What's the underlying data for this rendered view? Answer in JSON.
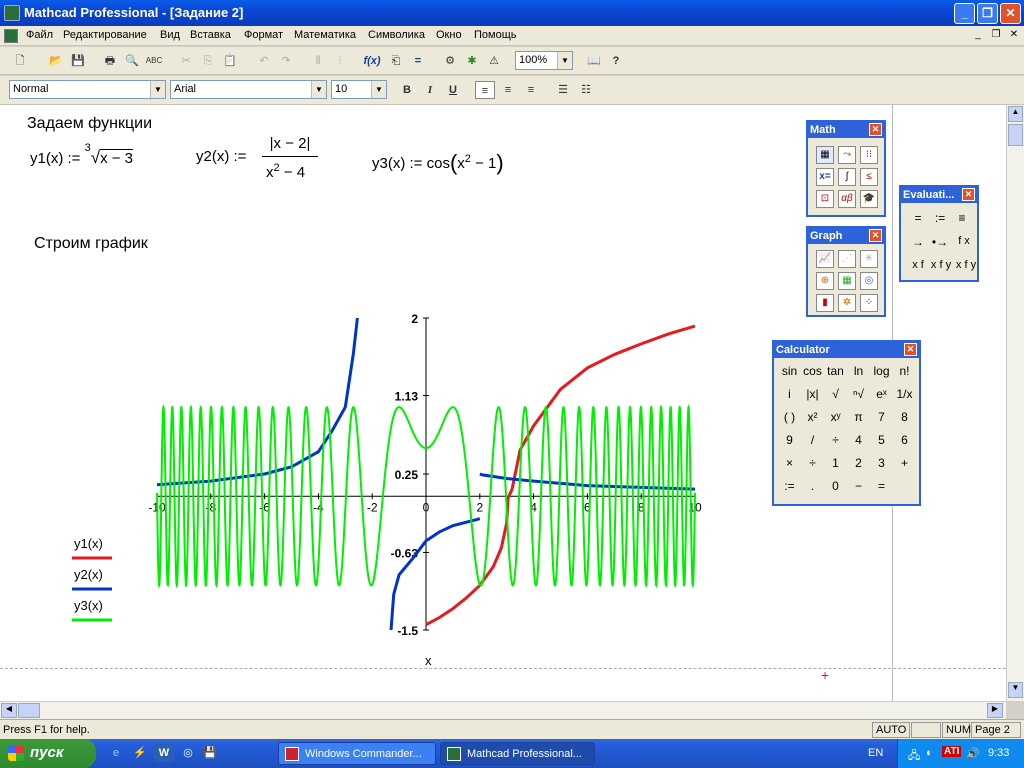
{
  "window": {
    "title": "Mathcad Professional - [Задание 2]"
  },
  "menu": [
    "Файл",
    "Редактирование",
    "Вид",
    "Вставка",
    "Формат",
    "Математика",
    "Символика",
    "Окно",
    "Помощь"
  ],
  "toolbar": {
    "zoom": "100%",
    "style": "Normal",
    "font": "Arial",
    "size": "10"
  },
  "worksheet": {
    "heading1": "Задаем функции",
    "heading2": "Строим график",
    "y1_def": "y1(x) :=",
    "y1_root_index": "3",
    "y1_radicand": "x − 3",
    "y2_def": "y2(x) :=",
    "y2_num": "|x − 2|",
    "y2_den_base": "x",
    "y2_den_exp": "2",
    "y2_den_rest": " − 4",
    "y3_def": "y3(x) :=",
    "y3_func": "cos",
    "y3_arg_base": "x",
    "y3_arg_exp": "2",
    "y3_arg_rest": " − 1",
    "plot_xlabel": "x"
  },
  "chart_data": {
    "type": "line",
    "xlim": [
      -10,
      10
    ],
    "ylim": [
      -1.5,
      2
    ],
    "x_ticks": [
      "-10",
      "-8",
      "-6",
      "-4",
      "-2",
      "0",
      "2",
      "4",
      "6",
      "8",
      "10"
    ],
    "y_ticks": [
      "2",
      "1.13",
      "0.25",
      "-0.63",
      "-1.5"
    ],
    "xlabel": "x",
    "series": [
      {
        "name": "y1(x)",
        "color": "#e41a1c",
        "points": [
          [
            3,
            -0.3
          ],
          [
            3.05,
            -0.02
          ],
          [
            3.2,
            0.08
          ],
          [
            3.5,
            0.52
          ],
          [
            4,
            0.79
          ],
          [
            5,
            1.2
          ],
          [
            6,
            1.44
          ],
          [
            7,
            1.59
          ],
          [
            8,
            1.71
          ],
          [
            9,
            1.82
          ],
          [
            10,
            1.91
          ]
        ]
      },
      {
        "name": "y1(x) left",
        "color": "#e41a1c",
        "points": [
          [
            0,
            -1.44
          ],
          [
            0.5,
            -1.36
          ],
          [
            1,
            -1.26
          ],
          [
            1.5,
            -1.14
          ],
          [
            2,
            -1.0
          ],
          [
            2.5,
            -0.79
          ],
          [
            2.8,
            -0.58
          ],
          [
            2.95,
            -0.37
          ],
          [
            3,
            -0.3
          ]
        ]
      },
      {
        "name": "y2(x)",
        "color": "#0033cc",
        "points": [
          [
            -10,
            0.13
          ],
          [
            -8,
            0.17
          ],
          [
            -6,
            0.25
          ],
          [
            -5,
            0.33
          ],
          [
            -4,
            0.5
          ],
          [
            -3.5,
            0.73
          ],
          [
            -3,
            1.0
          ],
          [
            -2.7,
            1.6
          ],
          [
            -2.55,
            2.0
          ]
        ]
      },
      {
        "name": "y2(x) mid",
        "color": "#0033cc",
        "points": [
          [
            -1.3,
            -1.5
          ],
          [
            -1.2,
            -1.1
          ],
          [
            -1,
            -0.88
          ],
          [
            -0.5,
            -0.7
          ],
          [
            0,
            -0.5
          ],
          [
            0.5,
            -0.4
          ],
          [
            1,
            -0.33
          ],
          [
            1.5,
            -0.29
          ],
          [
            1.9,
            -0.26
          ],
          [
            2,
            -0.25
          ]
        ]
      },
      {
        "name": "y2(x) right",
        "color": "#0033cc",
        "points": [
          [
            2,
            0.25
          ],
          [
            2,
            0.25
          ],
          [
            2.1,
            0.24
          ],
          [
            3,
            0.2
          ],
          [
            4,
            0.17
          ],
          [
            6,
            0.12
          ],
          [
            8,
            0.1
          ],
          [
            10,
            0.08
          ]
        ]
      },
      {
        "name": "y3(x)",
        "color": "#00ee00",
        "function": "cos(x^2-1)"
      }
    ],
    "legend": [
      "y1(x)",
      "y2(x)",
      "y3(x)"
    ]
  },
  "palettes": {
    "math": {
      "title": "Math"
    },
    "evaluation": {
      "title": "Evaluati...",
      "cells": [
        "=",
        ":=",
        "≡",
        "→",
        "•→",
        "f x",
        "x f",
        "x f y",
        "x f y"
      ]
    },
    "graph": {
      "title": "Graph"
    },
    "calculator": {
      "title": "Calculator",
      "cells": [
        "sin",
        "cos",
        "tan",
        "ln",
        "log",
        "n!",
        "i",
        "|x|",
        "√",
        "ⁿ√",
        "eˣ",
        "1/x",
        "( )",
        "x²",
        "xʸ",
        "π",
        "7",
        "8",
        "9",
        "/",
        "÷",
        "4",
        "5",
        "6",
        "×",
        "÷",
        "1",
        "2",
        "3",
        "+",
        ":=",
        ".",
        "0",
        "−",
        "="
      ]
    }
  },
  "status": {
    "help": "Press F1 for help.",
    "auto": "AUTO",
    "num": "NUM",
    "page": "Page 2"
  },
  "taskbar": {
    "start": "пуск",
    "tasks": [
      "Windows Commander...",
      "Mathcad Professional..."
    ],
    "lang": "EN",
    "time": "9:33"
  }
}
